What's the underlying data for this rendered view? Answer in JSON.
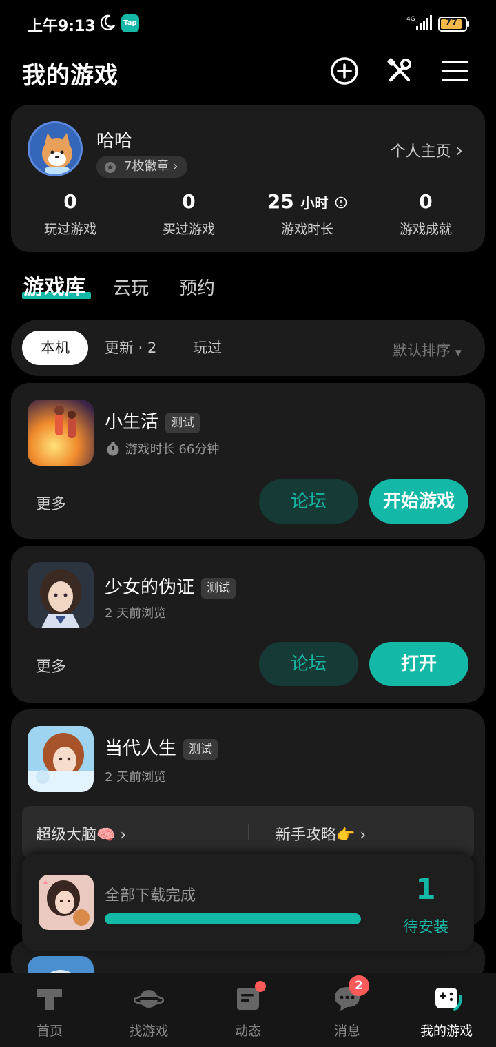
{
  "status_bar": {
    "time": "上午9:13",
    "tap_label": "Tap",
    "network": "4G",
    "battery": "77"
  },
  "header": {
    "title": "我的游戏",
    "icons": [
      "add-circle-icon",
      "tools-icon",
      "menu-icon"
    ]
  },
  "profile": {
    "name": "哈哈",
    "badges": "7枚徽章",
    "homepage": "个人主页",
    "stats": [
      {
        "value": "0",
        "unit": "",
        "label": "玩过游戏"
      },
      {
        "value": "0",
        "unit": "",
        "label": "买过游戏"
      },
      {
        "value": "25",
        "unit": "小时",
        "label": "游戏时长"
      },
      {
        "value": "0",
        "unit": "",
        "label": "游戏成就"
      }
    ]
  },
  "tabs": [
    "游戏库",
    "云玩",
    "预约"
  ],
  "filters": {
    "chips": [
      "本机",
      "更新 · 2",
      "玩过"
    ],
    "sort": "默认排序"
  },
  "games": [
    {
      "name": "小生活",
      "tag": "测试",
      "subtitle": "游戏时长 66分钟",
      "more": "更多",
      "forum": "论坛",
      "action": "开始游戏"
    },
    {
      "name": "少女的伪证",
      "tag": "测试",
      "subtitle": "2 天前浏览",
      "more": "更多",
      "forum": "论坛",
      "action": "打开"
    },
    {
      "name": "当代人生",
      "tag": "测试",
      "subtitle": "2 天前浏览",
      "links": [
        "超级大脑🧠",
        "新手攻略👉"
      ]
    }
  ],
  "download": {
    "status": "全部下载完成",
    "progress": 1.0,
    "count": "1",
    "count_label": "待安装"
  },
  "bottom_nav": [
    {
      "label": "首页",
      "icon": "home-t-icon"
    },
    {
      "label": "找游戏",
      "icon": "planet-icon"
    },
    {
      "label": "动态",
      "icon": "feed-icon"
    },
    {
      "label": "消息",
      "icon": "message-icon",
      "badge": "2"
    },
    {
      "label": "我的游戏",
      "icon": "gamepad-icon",
      "active": true
    }
  ],
  "colors": {
    "accent": "#14b8a6",
    "card": "#1c1c1c",
    "background": "#000000",
    "badge_red": "#ff5a5a"
  }
}
